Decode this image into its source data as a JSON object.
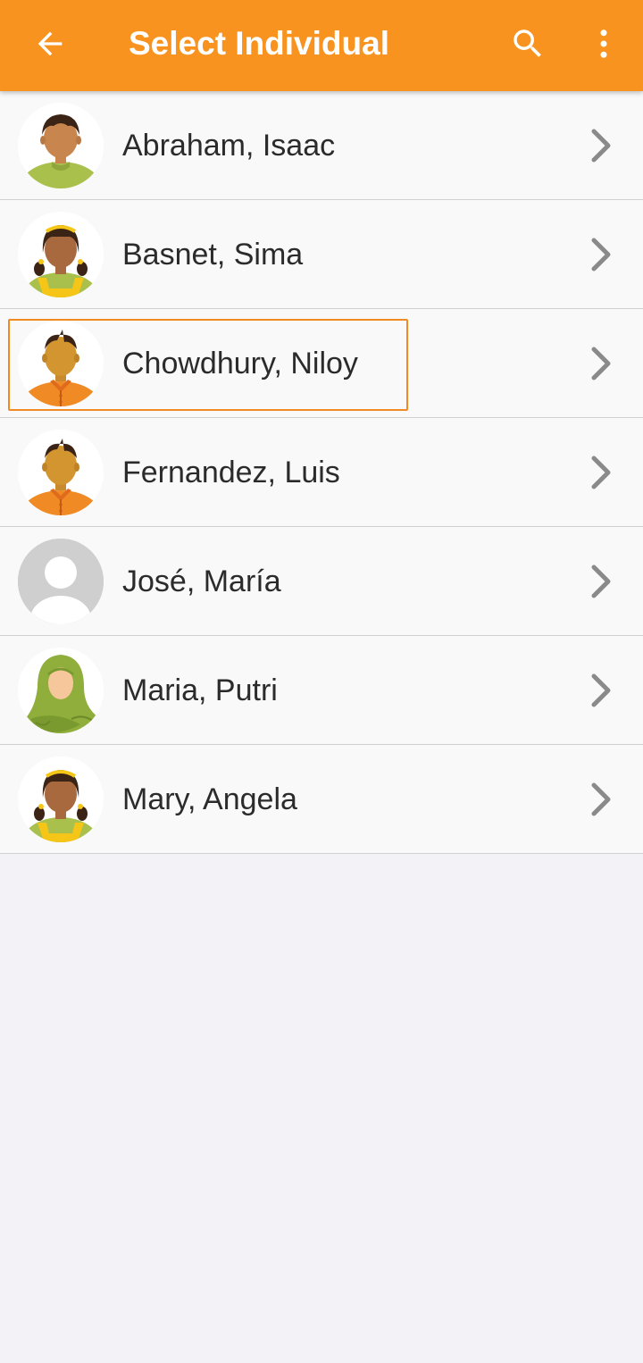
{
  "toolbar": {
    "title": "Select Individual",
    "back_icon": "arrow-back-icon",
    "search_icon": "search-icon",
    "menu_icon": "more-vertical-icon",
    "background_color": "#f7931e"
  },
  "individuals": [
    {
      "name": "Abraham, Isaac",
      "avatar": "boy-green-shirt-avatar"
    },
    {
      "name": "Basnet, Sima",
      "avatar": "girl-pigtails-avatar"
    },
    {
      "name": "Chowdhury, Niloy",
      "avatar": "boy-orange-shirt-avatar",
      "focused": true
    },
    {
      "name": "Fernandez, Luis",
      "avatar": "boy-orange-shirt-avatar"
    },
    {
      "name": "José, María",
      "avatar": "default-person-avatar"
    },
    {
      "name": "Maria, Putri",
      "avatar": "woman-hijab-avatar"
    },
    {
      "name": "Mary, Angela",
      "avatar": "girl-pigtails-avatar"
    }
  ],
  "colors": {
    "focus_outline": "#f08a24",
    "chevron": "#8a8a8a"
  }
}
